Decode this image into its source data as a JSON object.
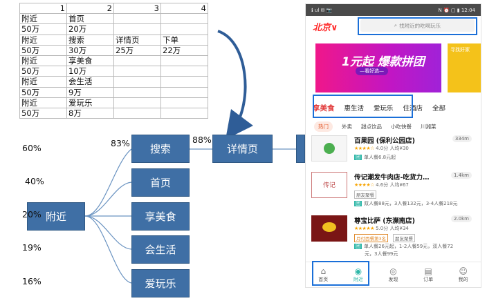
{
  "sheet": {
    "headers": [
      "1",
      "2",
      "3",
      "4"
    ],
    "rows": [
      [
        "附近",
        "首页",
        "",
        ""
      ],
      [
        "50万",
        "20万",
        "",
        ""
      ],
      [
        "附近",
        "搜索",
        "详情页",
        "下单"
      ],
      [
        "50万",
        "30万",
        "25万",
        "22万"
      ],
      [
        "附近",
        "享美食",
        "",
        ""
      ],
      [
        "50万",
        "10万",
        "",
        ""
      ],
      [
        "附近",
        "会生活",
        "",
        ""
      ],
      [
        "50万",
        "9万",
        "",
        ""
      ],
      [
        "附近",
        "爱玩乐",
        "",
        ""
      ],
      [
        "50万",
        "8万",
        "",
        ""
      ]
    ]
  },
  "flow": {
    "root": "附近",
    "branches": [
      "搜索",
      "首页",
      "享美食",
      "会生活",
      "爱玩乐"
    ],
    "detail": "详情页",
    "left_percents": [
      "60%",
      "40%",
      "20%",
      "19%",
      "16%"
    ],
    "pct_search": "83%",
    "pct_detail": "88%"
  },
  "phone": {
    "status_left": "ℹ ul ✉ 📷",
    "status_right": "N ⏰ ▢ ▮ 12:04",
    "logo": "北京∨",
    "search_placeholder": "找附近的吃喝玩乐",
    "banner_title": "1元起 爆款拼团",
    "banner_sub": "—看好选—",
    "banner_side": "寻找好家",
    "categories": [
      "享美食",
      "惠生活",
      "爱玩乐",
      "住酒店",
      "全部"
    ],
    "filters": [
      "热门",
      "外卖",
      "甜点饮品",
      "小吃快餐",
      "川湘菜"
    ],
    "shops": [
      {
        "name": "百果园 (保利公园店)",
        "distance": "334m",
        "stars": "★★★★☆",
        "rating": "4.0分",
        "price": "人均¥30",
        "tags": [],
        "deals": [
          "单人餐6.8元起"
        ]
      },
      {
        "name": "传记潮发牛肉店-吃货力…",
        "distance": "1.4km",
        "stars": "★★★★☆",
        "rating": "4.6分",
        "price": "人均¥67",
        "tags": [
          "朋友聚餐"
        ],
        "deals": [
          "双人餐88元，3人餐132元，3-4人餐218元"
        ]
      },
      {
        "name": "尊宝比萨 (东濒南店)",
        "distance": "2.0km",
        "stars": "★★★★★",
        "rating": "5.0分",
        "price": "人均¥34",
        "tags": [
          "月付西餐第3名",
          "朋友聚餐"
        ],
        "deals": [
          "单人餐26元起，1-2人餐59元，双人餐72",
          "元，3人餐99元"
        ]
      }
    ],
    "tabs": [
      {
        "label": "首页",
        "icon": "home-icon",
        "glyph": "⌂"
      },
      {
        "label": "附近",
        "icon": "location-icon",
        "glyph": "◉"
      },
      {
        "label": "发现",
        "icon": "discover-icon",
        "glyph": "◎"
      },
      {
        "label": "订单",
        "icon": "order-icon",
        "glyph": "▤"
      },
      {
        "label": "我的",
        "icon": "profile-icon",
        "glyph": "☺"
      }
    ]
  },
  "colors": {
    "node": "#3f6fa5",
    "highlight": "#1a6fd8",
    "accent_red": "#e23d3d",
    "accent_teal": "#2fb7a8"
  }
}
